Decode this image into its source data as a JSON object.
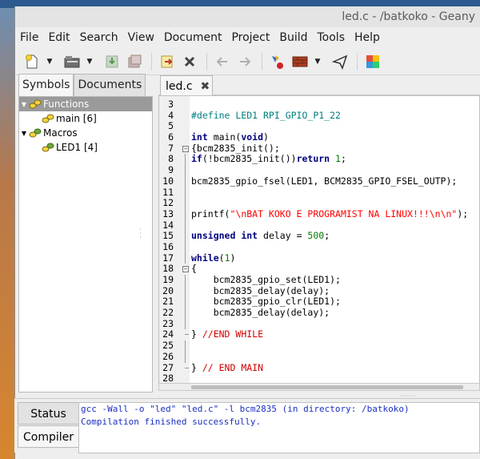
{
  "window": {
    "title": "led.c - /batkoko - Geany"
  },
  "menu": [
    "File",
    "Edit",
    "Search",
    "View",
    "Document",
    "Project",
    "Build",
    "Tools",
    "Help"
  ],
  "toolbar": {
    "icons": [
      "new-file-icon",
      "open-file-icon",
      "save-icon",
      "save-all-icon",
      "revert-icon",
      "close-icon",
      "back-arrow-icon",
      "forward-arrow-icon",
      "compile-icon",
      "build-icon",
      "execute-icon",
      "color-chooser-icon"
    ]
  },
  "sidebar": {
    "tabs": [
      "Symbols",
      "Documents"
    ],
    "tree": [
      {
        "label": "Functions",
        "level": 0,
        "selected": true
      },
      {
        "label": "main [6]",
        "level": 1,
        "selected": false
      },
      {
        "label": "Macros",
        "level": 0,
        "selected": false
      },
      {
        "label": "LED1 [4]",
        "level": 1,
        "selected": false
      }
    ]
  },
  "editor": {
    "tab_label": "led.c",
    "close_glyph": "✖",
    "lines": [
      {
        "n": "3",
        "t": ""
      },
      {
        "n": "4",
        "t": "#define LED1 RPI_GPIO_P1_22"
      },
      {
        "n": "5",
        "t": ""
      },
      {
        "n": "6",
        "t": "int main(void)"
      },
      {
        "n": "7",
        "t": "{bcm2835_init();"
      },
      {
        "n": "8",
        "t": "if(!bcm2835_init())return 1;"
      },
      {
        "n": "9",
        "t": ""
      },
      {
        "n": "10",
        "t": "bcm2835_gpio_fsel(LED1, BCM2835_GPIO_FSEL_OUTP);"
      },
      {
        "n": "11",
        "t": ""
      },
      {
        "n": "12",
        "t": ""
      },
      {
        "n": "13",
        "t": "printf(\"\\nBAT KOKO E PROGRAMIST NA LINUX!!!\\n\\n\");"
      },
      {
        "n": "14",
        "t": ""
      },
      {
        "n": "15",
        "t": "unsigned int delay = 500;"
      },
      {
        "n": "16",
        "t": ""
      },
      {
        "n": "17",
        "t": "while(1)"
      },
      {
        "n": "18",
        "t": "{"
      },
      {
        "n": "19",
        "t": "    bcm2835_gpio_set(LED1);"
      },
      {
        "n": "20",
        "t": "    bcm2835_delay(delay);"
      },
      {
        "n": "21",
        "t": "    bcm2835_gpio_clr(LED1);"
      },
      {
        "n": "22",
        "t": "    bcm2835_delay(delay);"
      },
      {
        "n": "23",
        "t": ""
      },
      {
        "n": "24",
        "t": "} //END WHILE"
      },
      {
        "n": "25",
        "t": ""
      },
      {
        "n": "26",
        "t": ""
      },
      {
        "n": "27",
        "t": "} // END MAIN"
      },
      {
        "n": "28",
        "t": ""
      }
    ]
  },
  "bottom": {
    "tabs": [
      "Status",
      "Compiler"
    ],
    "messages": [
      "gcc -Wall -o \"led\" \"led.c\" -l bcm2835 (in directory: /batkoko)",
      "Compilation finished successfully."
    ]
  }
}
